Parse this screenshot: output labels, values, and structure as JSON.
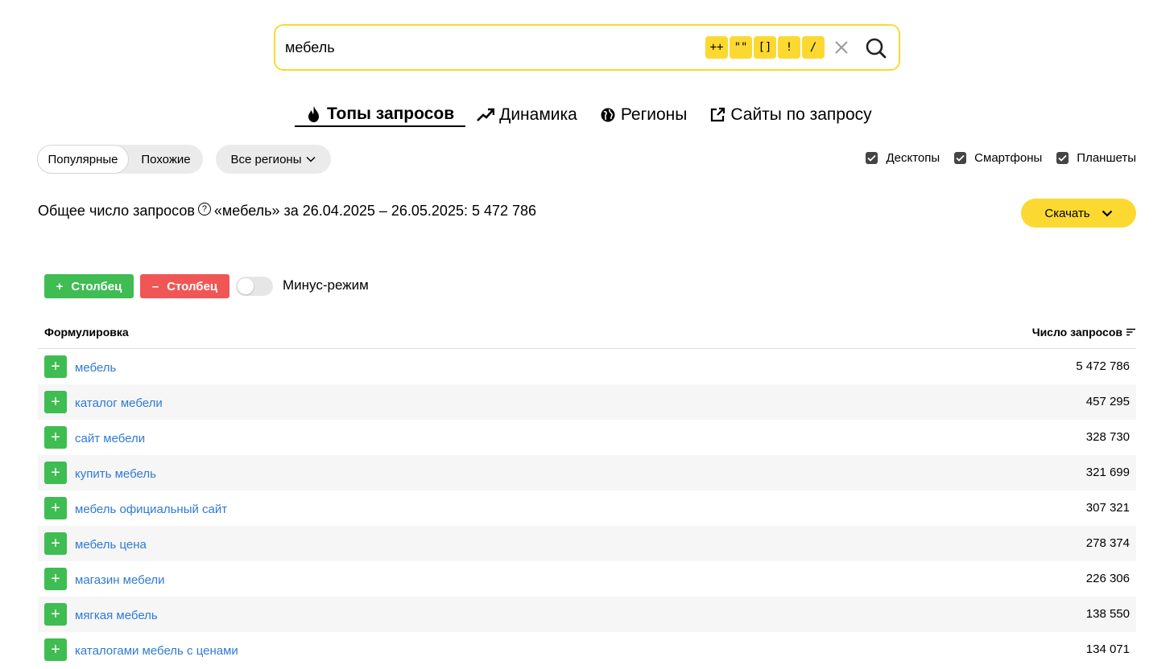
{
  "search": {
    "value": "мебель",
    "operators": [
      "++",
      "\"\"",
      "[]",
      "!",
      "/"
    ]
  },
  "tabs": [
    {
      "label": "Топы запросов",
      "icon": "fire-icon"
    },
    {
      "label": "Динамика",
      "icon": "trend-up-icon"
    },
    {
      "label": "Регионы",
      "icon": "globe-icon"
    },
    {
      "label": "Сайты по запросу",
      "icon": "external-link-icon"
    }
  ],
  "filters": {
    "popular": "Популярные",
    "similar": "Похожие",
    "regions": "Все регионы"
  },
  "devices": [
    {
      "label": "Десктопы",
      "checked": true
    },
    {
      "label": "Смартфоны",
      "checked": true
    },
    {
      "label": "Планшеты",
      "checked": true
    }
  ],
  "summary": {
    "label": "Общее число запросов",
    "detail": "«мебель» за 26.04.2025 – 26.05.2025: 5 472 786"
  },
  "download_label": "Скачать",
  "columns": {
    "add_label": "Столбец",
    "remove_label": "Столбец",
    "minus_mode": "Минус-режим"
  },
  "table": {
    "col_phrase": "Формулировка",
    "col_count": "Число запросов",
    "rows": [
      {
        "phrase": "мебель",
        "count": "5 472 786"
      },
      {
        "phrase": "каталог мебели",
        "count": "457 295"
      },
      {
        "phrase": "сайт мебели",
        "count": "328 730"
      },
      {
        "phrase": "купить мебель",
        "count": "321 699"
      },
      {
        "phrase": "мебель официальный сайт",
        "count": "307 321"
      },
      {
        "phrase": "мебель цена",
        "count": "278 374"
      },
      {
        "phrase": "магазин мебели",
        "count": "226 306"
      },
      {
        "phrase": "мягкая мебель",
        "count": "138 550"
      },
      {
        "phrase": "каталогами мебель с ценами",
        "count": "134 071"
      }
    ]
  },
  "colors": {
    "accent_yellow": "#fcd931",
    "add_green": "#3fbc52",
    "remove_red": "#f05656",
    "link_blue": "#2f7ad5"
  }
}
